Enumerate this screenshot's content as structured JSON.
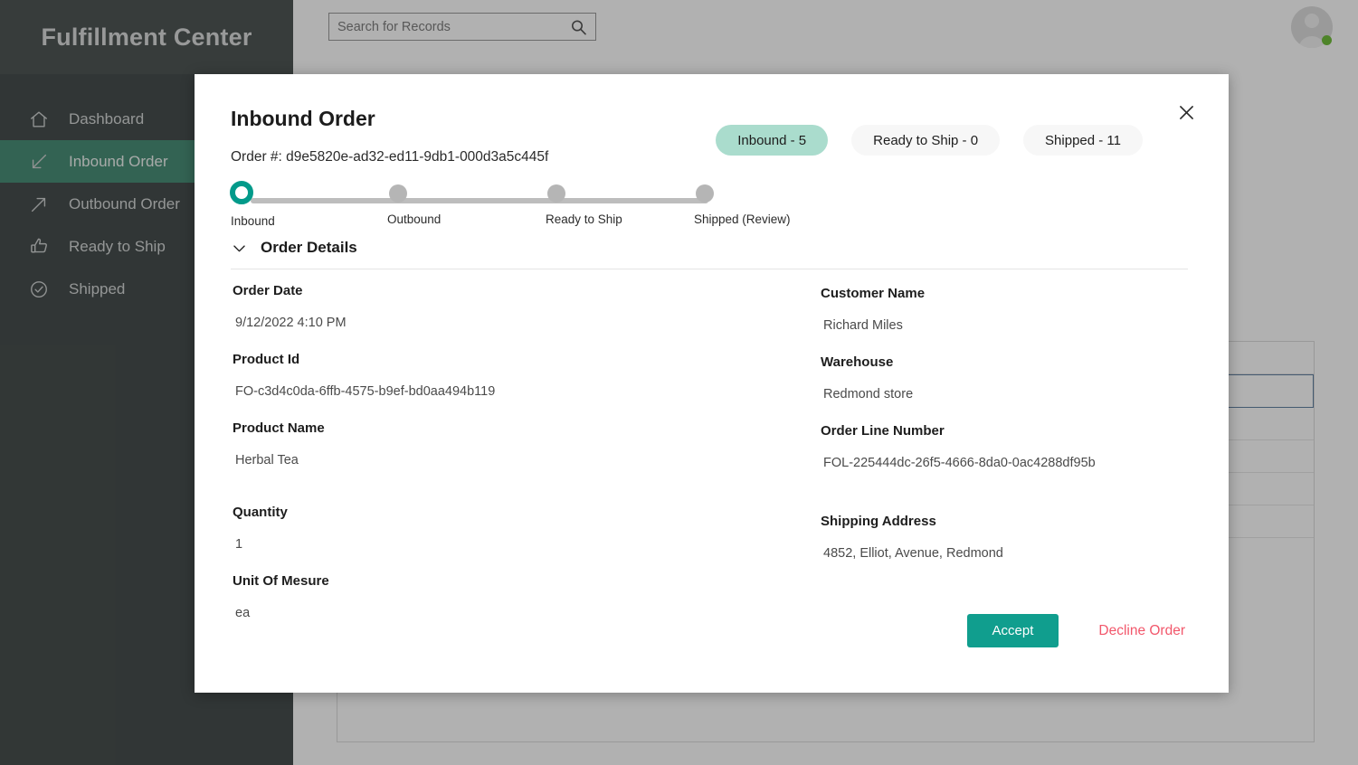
{
  "app": {
    "brand_title": "Fulfillment Center"
  },
  "sidebar": {
    "items": [
      {
        "label": "Dashboard",
        "icon": "home-icon",
        "active": false
      },
      {
        "label": "Inbound Order",
        "icon": "arrow-down-left-icon",
        "active": true
      },
      {
        "label": "Outbound Order",
        "icon": "arrow-up-right-icon",
        "active": false
      },
      {
        "label": "Ready to Ship",
        "icon": "thumbs-up-icon",
        "active": false
      },
      {
        "label": "Shipped",
        "icon": "check-circle-icon",
        "active": false
      }
    ]
  },
  "topbar": {
    "search": {
      "placeholder": "Search for Records",
      "value": "",
      "icon": "search-icon"
    },
    "avatar": {
      "icon": "avatar-icon",
      "status": "online",
      "status_color": "#5ab41d"
    }
  },
  "modal": {
    "title": "Inbound Order",
    "order_number_label": "Order #: d9e5820e-ad32-ed11-9db1-000d3a5c445f",
    "close_icon": "close-icon",
    "pills": [
      {
        "label": "Inbound - 5",
        "active": true
      },
      {
        "label": "Ready to Ship - 0",
        "active": false
      },
      {
        "label": "Shipped - 11",
        "active": false
      }
    ],
    "stepper": {
      "steps": [
        {
          "label": "Inbound",
          "state": "current"
        },
        {
          "label": "Outbound",
          "state": "pending"
        },
        {
          "label": "Ready to Ship",
          "state": "pending"
        },
        {
          "label": "Shipped (Review)",
          "state": "pending"
        }
      ]
    },
    "details": {
      "section_title": "Order Details",
      "chevron_icon": "chevron-down-icon",
      "left_fields": [
        {
          "label": "Order Date",
          "value": "9/12/2022 4:10 PM"
        },
        {
          "label": "Product Id",
          "value": "FO-c3d4c0da-6ffb-4575-b9ef-bd0aa494b119"
        },
        {
          "label": "Product Name",
          "value": "Herbal Tea"
        },
        {
          "label": "Quantity",
          "value": "1"
        },
        {
          "label": "Unit Of Mesure",
          "value": "ea"
        }
      ],
      "right_fields": [
        {
          "label": "Customer Name",
          "value": "Richard Miles"
        },
        {
          "label": "Warehouse",
          "value": "Redmond store"
        },
        {
          "label": "Order Line Number",
          "value": "FOL-225444dc-26f5-4666-8da0-0ac4288df95b"
        },
        {
          "label": "Shipping Address",
          "value": "4852, Elliot, Avenue, Redmond"
        }
      ]
    },
    "actions": {
      "accept_label": "Accept",
      "decline_label": "Decline Order"
    }
  },
  "colors": {
    "sidebar_bg": "#2b3332",
    "sidebar_header_bg": "#343c3b",
    "sidebar_active": "#2e7d63",
    "accent_teal": "#029a8a",
    "accept_button": "#109e8e",
    "decline_text": "#f2576b",
    "pill_active_bg": "#aadccd",
    "status_dot": "#5ab41d",
    "selected_row_border": "#4a6f95"
  },
  "background": {
    "record_rows": [
      {
        "selected": false
      },
      {
        "selected": true
      },
      {
        "selected": false
      },
      {
        "selected": false
      },
      {
        "selected": false
      },
      {
        "selected": false
      }
    ]
  }
}
